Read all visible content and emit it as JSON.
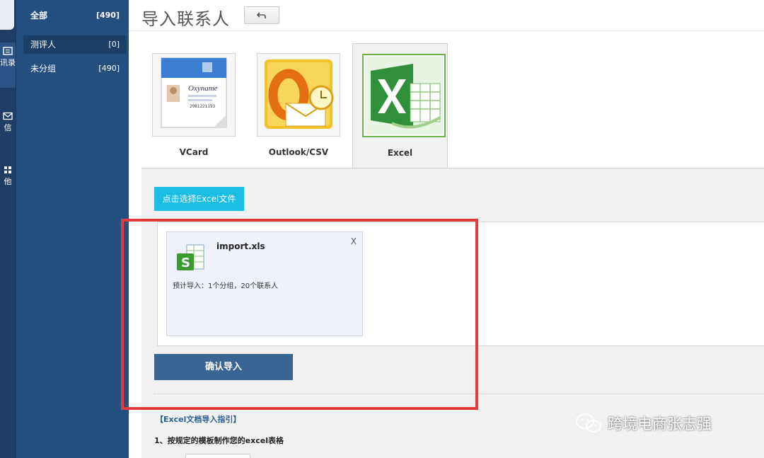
{
  "rail": {
    "items": [
      {
        "label": "讯录",
        "icon": "contacts-icon"
      },
      {
        "label": "信",
        "icon": "mail-icon"
      },
      {
        "label": "他",
        "icon": "grid-icon"
      }
    ]
  },
  "groups": [
    {
      "name": "全部",
      "count": "[490]"
    },
    {
      "name": "测评人",
      "count": "[0]"
    },
    {
      "name": "未分组",
      "count": "[490]"
    }
  ],
  "header": {
    "title": "导入联系人"
  },
  "tabs": [
    {
      "label": "VCard",
      "icon": "vcard-icon",
      "card_name": "Oxyname",
      "card_number": "2981221193"
    },
    {
      "label": "Outlook/CSV",
      "icon": "outlook-icon"
    },
    {
      "label": "Excel",
      "icon": "excel-icon"
    }
  ],
  "import": {
    "choose_label": "点击选择Excel文件",
    "file_name": "import.xls",
    "close_label": "X",
    "info": "预计导入：1个分组，20个联系人",
    "confirm_label": "确认导入"
  },
  "guide": {
    "title": "【Excel文档导入指引】",
    "step1": "1、按规定的模板制作您的excel表格"
  },
  "watermark": {
    "text": "跨境电商张志强"
  },
  "colors": {
    "sidebar": "#24507f",
    "accent": "#1bbde4",
    "confirm": "#3a6592",
    "highlight": "#e23b3b",
    "excel_green": "#2f8f3a"
  }
}
